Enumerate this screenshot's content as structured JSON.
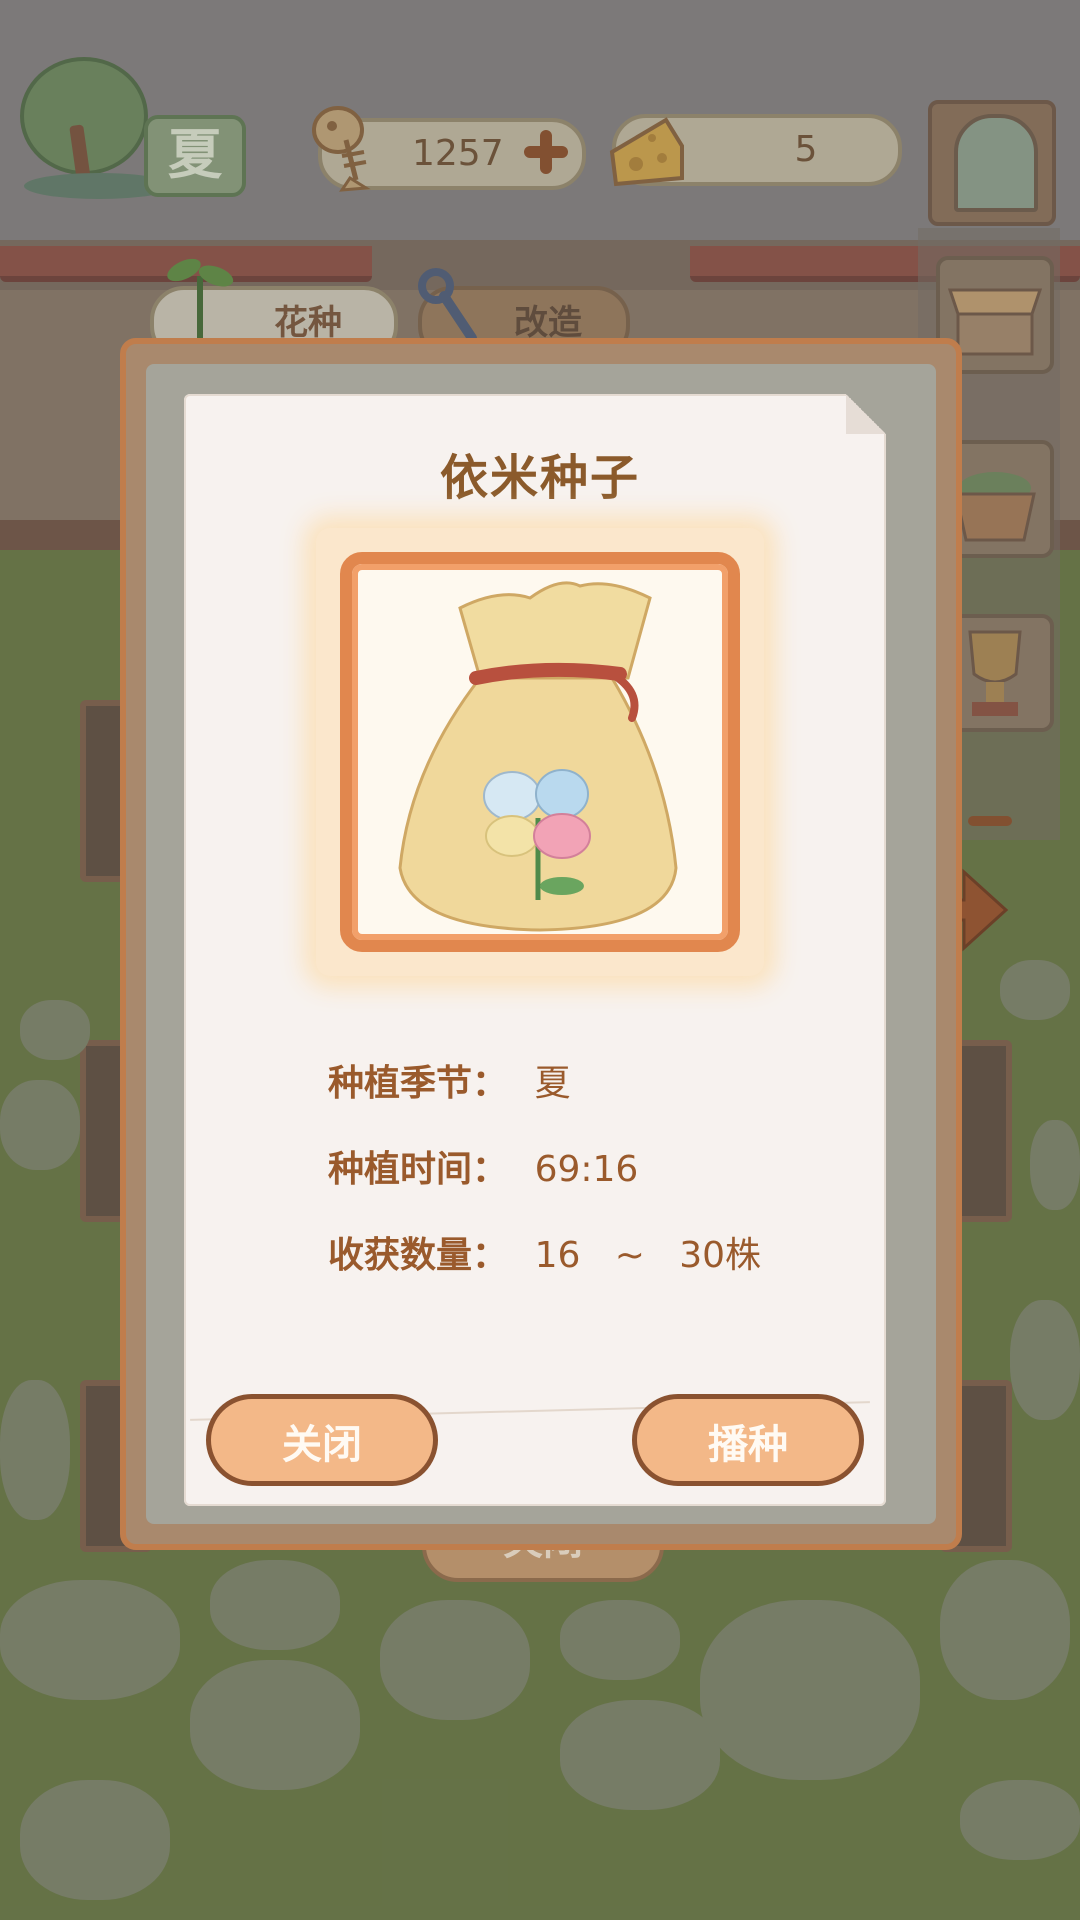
{
  "hud": {
    "season": "夏",
    "fish_count": "1257",
    "cheese_count": "5"
  },
  "tabs": {
    "flower_seed": "花种",
    "modify": "改造"
  },
  "dialog": {
    "title": "依米种子",
    "season_label": "种植季节：",
    "season_value": "夏",
    "time_label": "种植时间：",
    "time_value": "69:16",
    "yield_label": "收获数量：",
    "yield_value": "16   ~   30株",
    "close_button": "关闭",
    "sow_button": "播种"
  },
  "background_close_button": "关闭",
  "icons": [
    "fish-bone-icon",
    "plus-icon",
    "cheese-icon",
    "window-icon",
    "shop-icon",
    "basket-icon",
    "trophy-icon",
    "minus-icon",
    "arrow-right-icon",
    "sprout-icon",
    "wrench-icon",
    "seed-bag-icon"
  ],
  "colors": {
    "accent_orange": "#f3b888",
    "title_brown": "#8b5a2b",
    "frame_orange": "#e1874e"
  }
}
